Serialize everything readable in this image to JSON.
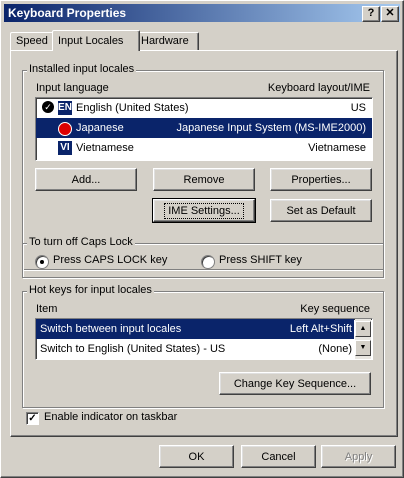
{
  "window": {
    "title": "Keyboard Properties",
    "help_icon": "?",
    "close_icon": "✕"
  },
  "tabs": [
    {
      "label": "Speed"
    },
    {
      "label": "Input Locales"
    },
    {
      "label": "Hardware"
    }
  ],
  "installed": {
    "legend": "Installed input locales",
    "col_language": "Input language",
    "col_layout": "Keyboard layout/IME",
    "rows": [
      {
        "code": "EN",
        "language": "English (United States)",
        "layout": "US",
        "default": true
      },
      {
        "code": "JP",
        "language": "Japanese",
        "layout": "Japanese Input System (MS-IME2000)",
        "default": false
      },
      {
        "code": "VI",
        "language": "Vietnamese",
        "layout": "Vietnamese",
        "default": false
      }
    ],
    "add_label": "Add...",
    "remove_label": "Remove",
    "properties_label": "Properties...",
    "ime_label": "IME Settings...",
    "set_default_label": "Set as Default"
  },
  "caps": {
    "legend": "To turn off Caps Lock",
    "option1": "Press CAPS LOCK key",
    "option2": "Press SHIFT key",
    "selected": "option1"
  },
  "hotkeys": {
    "legend": "Hot keys for input locales",
    "col_item": "Item",
    "col_seq": "Key sequence",
    "rows": [
      {
        "item": "Switch between input locales",
        "seq": "Left Alt+Shift"
      },
      {
        "item": "Switch to English (United States) - US",
        "seq": "(None)"
      }
    ],
    "change_label": "Change Key Sequence..."
  },
  "indicator": {
    "label": "Enable indicator on taskbar",
    "checked": true
  },
  "footer": {
    "ok_label": "OK",
    "cancel_label": "Cancel",
    "apply_label": "Apply"
  }
}
